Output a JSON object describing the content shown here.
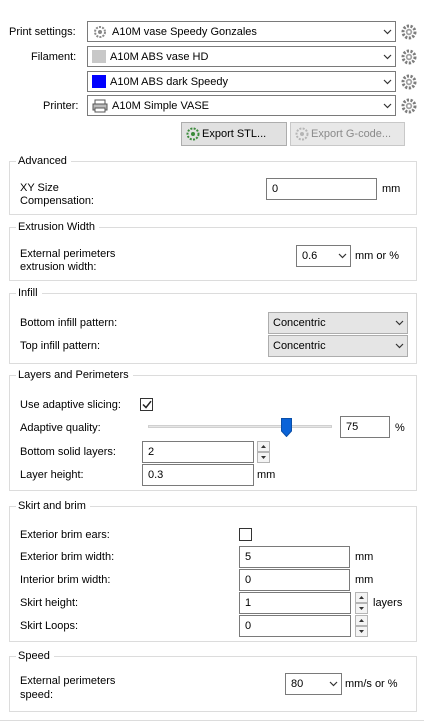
{
  "presets": {
    "print_label": "Print settings:",
    "print_value": "A10M vase Speedy Gonzales",
    "filament_label": "Filament:",
    "filament_1_value": "A10M ABS vase HD",
    "filament_1_color": "#c8c8c8",
    "filament_2_value": "A10M ABS dark Speedy",
    "filament_2_color": "#0000ff",
    "printer_label": "Printer:",
    "printer_value": "A10M Simple VASE"
  },
  "buttons": {
    "export_stl": "Export STL...",
    "export_gcode": "Export G-code..."
  },
  "advanced": {
    "title": "Advanced",
    "xy_label_1": "XY Size",
    "xy_label_2": "Compensation:",
    "xy_value": "0",
    "xy_unit": "mm"
  },
  "extrusion": {
    "title": "Extrusion Width",
    "ext_label_1": "External perimeters",
    "ext_label_2": "extrusion width:",
    "ext_value": "0.6",
    "ext_unit": "mm or %"
  },
  "infill": {
    "title": "Infill",
    "bottom_label": "Bottom infill pattern:",
    "bottom_value": "Concentric",
    "top_label": "Top infill pattern:",
    "top_value": "Concentric"
  },
  "layers": {
    "title": "Layers and Perimeters",
    "adaptive_label": "Use adaptive slicing:",
    "adaptive_checked": true,
    "quality_label": "Adaptive quality:",
    "quality_value": "75",
    "quality_level": 0.75,
    "quality_unit": "%",
    "bottom_solid_label": "Bottom solid layers:",
    "bottom_solid_value": "2",
    "layer_height_label": "Layer height:",
    "layer_height_value": "0.3",
    "layer_height_unit": "mm"
  },
  "skirt": {
    "title": "Skirt and brim",
    "ears_label": "Exterior brim ears:",
    "ears_checked": false,
    "ext_brim_label": "Exterior brim width:",
    "ext_brim_value": "5",
    "ext_brim_unit": "mm",
    "int_brim_label": "Interior brim width:",
    "int_brim_value": "0",
    "int_brim_unit": "mm",
    "skirt_height_label": "Skirt height:",
    "skirt_height_value": "1",
    "skirt_height_unit": "layers",
    "skirt_loops_label": "Skirt Loops:",
    "skirt_loops_value": "0"
  },
  "speed": {
    "title": "Speed",
    "ext_speed_label_1": "External perimeters",
    "ext_speed_label_2": "speed:",
    "ext_speed_value": "80",
    "ext_speed_unit": "mm/s or %"
  }
}
